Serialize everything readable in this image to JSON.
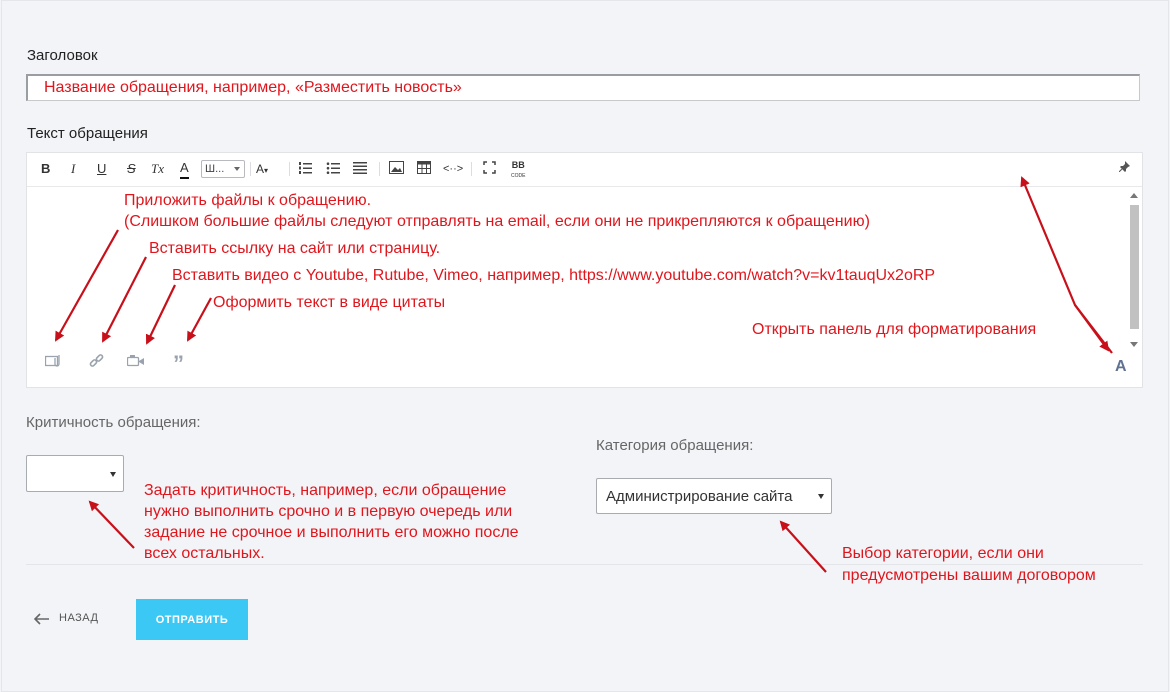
{
  "form": {
    "title_label": "Заголовок",
    "title_placeholder": "Название обращения, например, «Разместить новость»",
    "text_label": "Текст обращения",
    "font_select": "Ш...",
    "toolbar": {
      "bold": "B",
      "italic": "I",
      "underline": "U",
      "strike": "S",
      "clear": "Tx",
      "color": "A",
      "size": "A",
      "bbcode": "BB"
    },
    "format_panel_label": "A",
    "criticality_label": "Критичность обращения:",
    "criticality_value": "",
    "category_label": "Категория обращения:",
    "category_value": "Администрирование сайта",
    "back_label": "НАЗАД",
    "submit_label": "ОТПРАВИТЬ"
  },
  "annotations": {
    "attach_line1": "Приложить файлы к обращению.",
    "attach_line2": "(Слишком большие файлы следуют отправлять на email, если они не прикрепляются к обращению)",
    "link": "Вставить ссылку на сайт или страницу.",
    "video": "Вставить видео с Youtube, Rutube, Vimeo, например, https://www.youtube.com/watch?v=kv1tauqUx2oRP",
    "quote": "Оформить текст в виде цитаты",
    "format": "Открыть панель для форматирования",
    "criticality_1": "Задать критичность, например, если обращение",
    "criticality_2": "нужно выполнить срочно и в первую очередь или",
    "criticality_3": "задание не срочное и выполнить его можно после",
    "criticality_4": "всех остальных.",
    "category_1": "Выбор категории, если они",
    "category_2": "предусмотрены вашим договором"
  },
  "colors": {
    "annotation": "#e0161d",
    "accent": "#3bc8f5"
  },
  "icons": [
    "bold-icon",
    "italic-icon",
    "underline-icon",
    "strikethrough-icon",
    "clear-format-icon",
    "text-color-icon",
    "font-size-icon",
    "ordered-list-icon",
    "unordered-list-icon",
    "align-icon",
    "image-icon",
    "table-icon",
    "code-icon",
    "fullscreen-icon",
    "bbcode-icon",
    "pin-icon",
    "attach-file-icon",
    "link-icon",
    "video-icon",
    "quote-icon"
  ]
}
